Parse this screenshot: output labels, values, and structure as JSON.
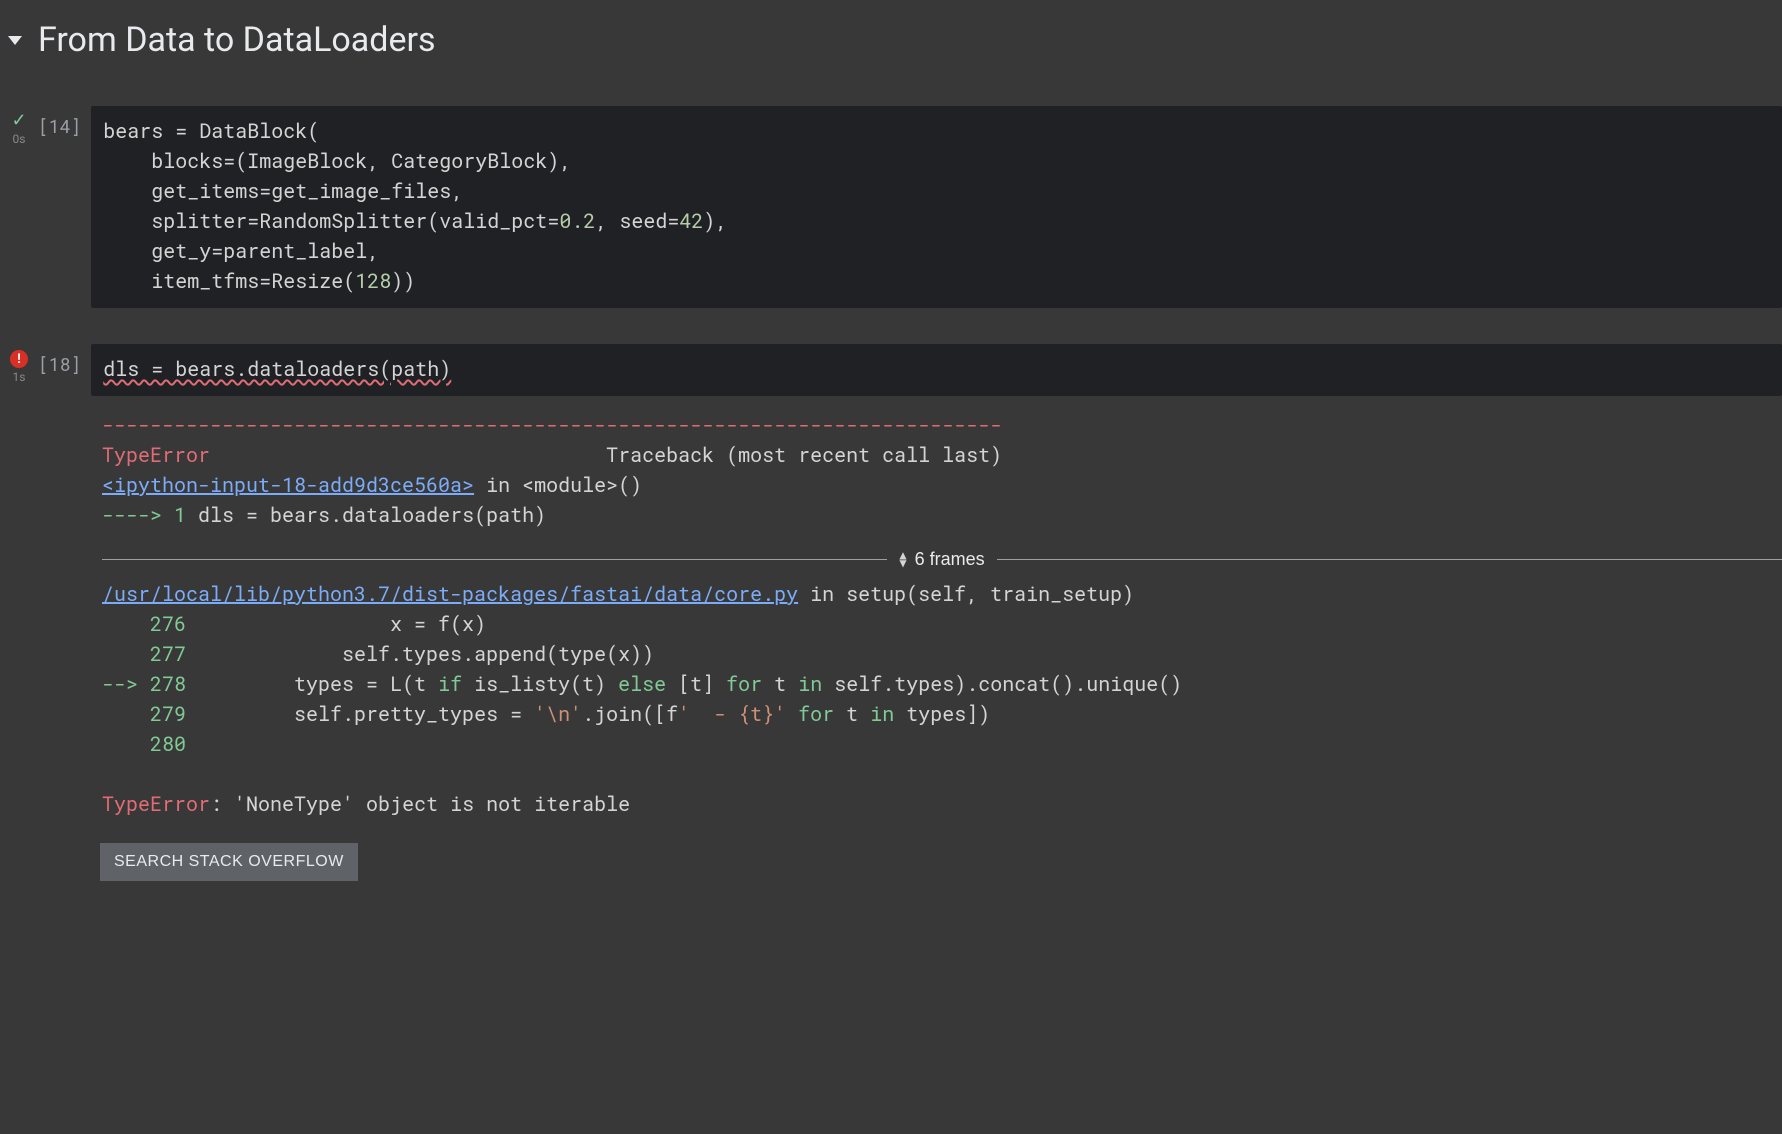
{
  "section": {
    "title": "From Data to DataLoaders"
  },
  "cell1": {
    "status": "✓",
    "time": "0s",
    "prompt": "[14]",
    "code": {
      "l1a": "bears ",
      "l1b": "=",
      "l1c": " DataBlock(",
      "l2a": "    blocks",
      "l2b": "=",
      "l2c": "(ImageBlock, CategoryBlock),",
      "l3a": "    get_items",
      "l3b": "=",
      "l3c": "get_image_files,",
      "l4a": "    splitter",
      "l4b": "=",
      "l4c": "RandomSplitter(valid_pct",
      "l4d": "=",
      "l4e": "0.2",
      "l4f": ", seed",
      "l4g": "=",
      "l4h": "42",
      "l4i": "),",
      "l5a": "    get_y",
      "l5b": "=",
      "l5c": "parent_label,",
      "l6a": "    item_tfms",
      "l6b": "=",
      "l6c": "Resize(",
      "l6d": "128",
      "l6e": "))"
    }
  },
  "cell2": {
    "status": "!",
    "time": "1s",
    "prompt": "[18]",
    "code": {
      "l1": "dls = bears.dataloaders(path)"
    },
    "output": {
      "sep": "---------------------------------------------------------------------------",
      "exc_name": "TypeError",
      "exc_tail": "                                 Traceback (most recent call last)",
      "src_link": "<ipython-input-18-add9d3ce560a>",
      "src_tail": " in <module>()",
      "arrow1": "----> ",
      "ln1": "1",
      "line1": " dls = bears.dataloaders(path)",
      "frames_label": "6 frames",
      "file_link": "/usr/local/lib/python3.7/dist-packages/fastai/data/core.py",
      "file_tail": " in setup(self, train_setup)",
      "r276n": "    276",
      "r276": "                 x = f(x)",
      "r277n": "    277",
      "r277": "             self.types.append(type(x))",
      "r278a": "--> ",
      "r278n": "278",
      "r278b": "         types = L(t ",
      "r278c": "if",
      "r278d": " is_listy(t) ",
      "r278e": "else",
      "r278f": " [t] ",
      "r278g": "for",
      "r278h": " t ",
      "r278i": "in",
      "r278j": " self.types).concat().unique()",
      "r279n": "    279",
      "r279a": "         self.pretty_types = ",
      "r279b": "'\\n'",
      "r279c": ".join([f",
      "r279d": "'  - {t}'",
      "r279e": " ",
      "r279f": "for",
      "r279g": " t ",
      "r279h": "in",
      "r279i": " types])",
      "r280n": "    280",
      "final_exc": "TypeError",
      "final_msg": ": 'NoneType' object is not iterable"
    },
    "button": "SEARCH STACK OVERFLOW"
  }
}
